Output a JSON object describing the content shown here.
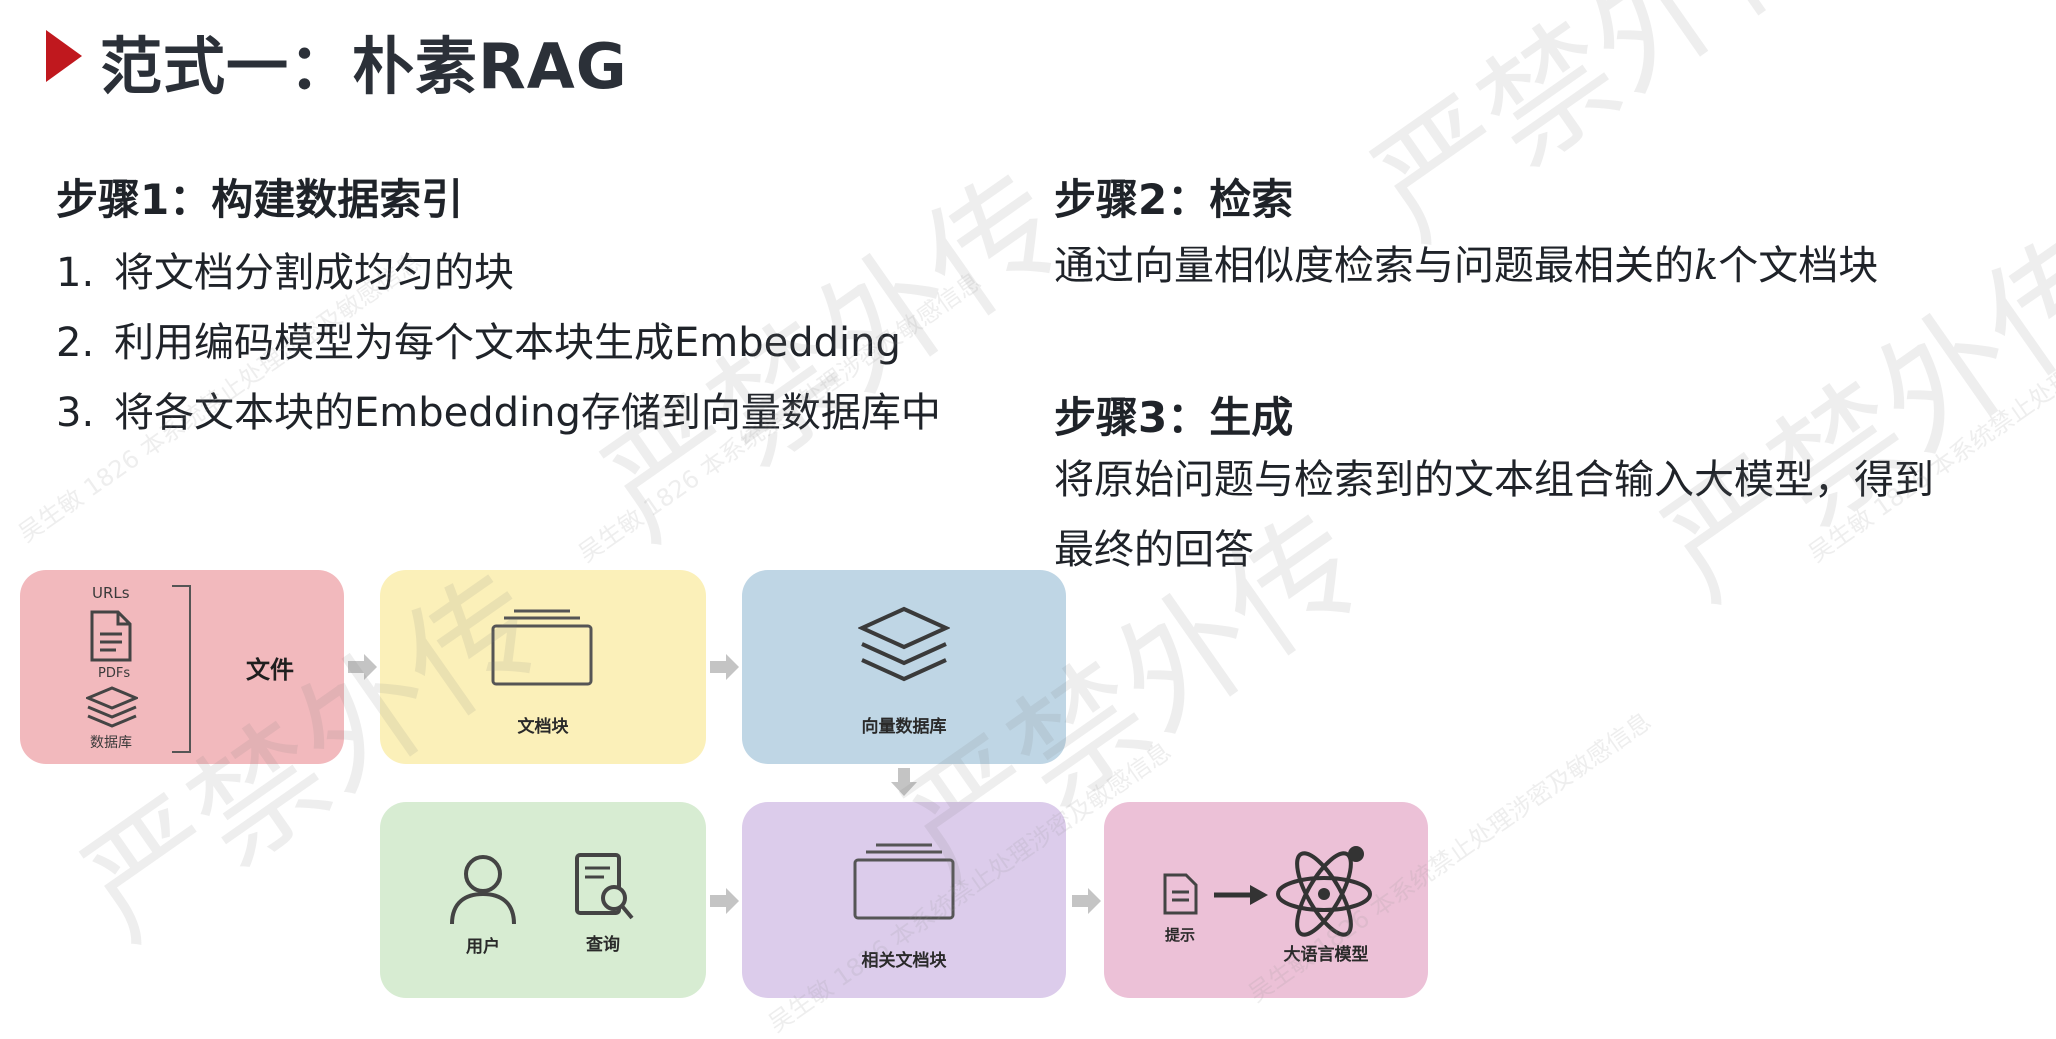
{
  "title": "范式一：朴素RAG",
  "step1": {
    "heading": "步骤1：构建数据索引",
    "items": [
      {
        "num": "1.",
        "text": "将文档分割成均匀的块"
      },
      {
        "num": "2.",
        "text": "利用编码模型为每个文本块生成Embedding"
      },
      {
        "num": "3.",
        "text": "将各文本块的Embedding存储到向量数据库中"
      }
    ]
  },
  "step2": {
    "heading": "步骤2：检索",
    "text_before": "通过向量相似度检索与问题最相关的",
    "k": "k",
    "text_after": "个文档块"
  },
  "step3": {
    "heading": "步骤3：生成",
    "line1": "将原始问题与检索到的文本组合输入大模型，得到",
    "line2": "最终的回答"
  },
  "diagram": {
    "urls": "URLs",
    "pdfs": "PDFs",
    "database": "数据库",
    "documents": "文件",
    "chunks": "文档块",
    "vector_db": "向量数据库",
    "user": "用户",
    "query": "查询",
    "related_chunks": "相关文档块",
    "prompt": "提示",
    "llm": "大语言模型"
  },
  "watermark": {
    "big": "严禁外传",
    "small": "吴生敏 1826 本系统禁止处理涉密及敏感信息"
  },
  "colors": {
    "accent": "#c0181e",
    "docs_box": "#f2b9bd",
    "chunks_box": "#fbf0b9",
    "vdb_box": "#bfd6e5",
    "user_box": "#d7ecd2",
    "related_box": "#dccceb",
    "llm_box": "#ecc1d7",
    "arrow": "#c4c4c4"
  }
}
